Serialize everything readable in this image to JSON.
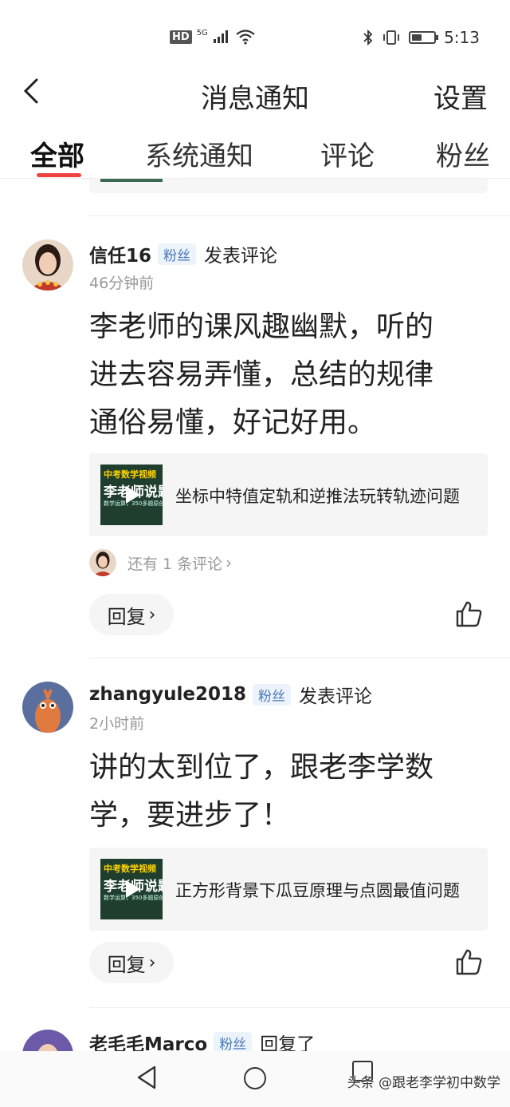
{
  "status_bar": {
    "network_hd": "HD",
    "network_gen": "5G",
    "time": "5:13"
  },
  "header": {
    "title": "消息通知",
    "settings_label": "设置"
  },
  "tabs": [
    {
      "label": "全部",
      "active": true
    },
    {
      "label": "系统通知",
      "active": false
    },
    {
      "label": "评论",
      "active": false
    },
    {
      "label": "粉丝",
      "active": false
    }
  ],
  "notifications": [
    {
      "username": "信任16",
      "badge": "粉丝",
      "action": "发表评论",
      "time": "46分钟前",
      "comment_lines": [
        "李老师的课风趣幽默，听的",
        "进去容易弄懂，总结的规律",
        "通俗易懂，好记好用。"
      ],
      "video_title": "坐标中特值定轨和逆推法玩转轨迹问题",
      "thumb_text": {
        "line1": "中考数学视频",
        "line2": "李老师说题",
        "line3": "数学运算，350多题原创精选"
      },
      "more_comments": "还有 1 条评论",
      "reply_label": "回复"
    },
    {
      "username": "zhangyule2018",
      "badge": "粉丝",
      "action": "发表评论",
      "time": "2小时前",
      "comment_lines": [
        "讲的太到位了，跟老李学数",
        "学，要进步了！"
      ],
      "video_title": "正方形背景下瓜豆原理与点圆最值问题",
      "thumb_text": {
        "line1": "中考数学视频",
        "line2": "李老师说题",
        "line3": "数学运算，350多题原创精选"
      },
      "reply_label": "回复"
    },
    {
      "username": "老毛毛Marco",
      "badge": "粉丝",
      "action": "回复了"
    }
  ],
  "watermark": "头条 @跟老李学初中数学",
  "colors": {
    "accent": "#f04142",
    "badge_text": "#4a78b8",
    "badge_bg": "#edf3fb"
  },
  "icons": [
    "back-chevron-icon",
    "thumbs-up-icon",
    "chevron-right-icon",
    "nav-back-icon",
    "nav-home-icon",
    "nav-recent-icon"
  ]
}
